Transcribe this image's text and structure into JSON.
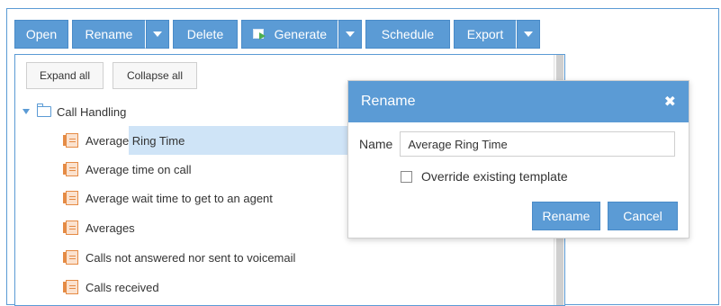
{
  "toolbar": {
    "open": "Open",
    "rename": "Rename",
    "delete": "Delete",
    "generate": "Generate",
    "schedule": "Schedule",
    "export": "Export"
  },
  "panel": {
    "expand_all": "Expand all",
    "collapse_all": "Collapse all",
    "tree": {
      "root_label": "Call Handling",
      "items": [
        "Average Ring Time",
        "Average time on call",
        "Average wait time to get to an agent",
        "Averages",
        "Calls not answered nor sent to voicemail",
        "Calls received"
      ],
      "selected_index": 0
    }
  },
  "dialog": {
    "title": "Rename",
    "name_label": "Name",
    "name_value": "Average Ring Time",
    "override_label": "Override existing template",
    "override_checked": false,
    "rename_button": "Rename",
    "cancel_button": "Cancel"
  },
  "icons": {
    "dropdown": "chevron-down-icon",
    "generate": "generate-icon",
    "folder": "folder-open-icon",
    "report": "report-document-icon",
    "close": "close-icon"
  },
  "colors": {
    "accent": "#5b9bd5",
    "selected_row": "#cfe4f7"
  }
}
